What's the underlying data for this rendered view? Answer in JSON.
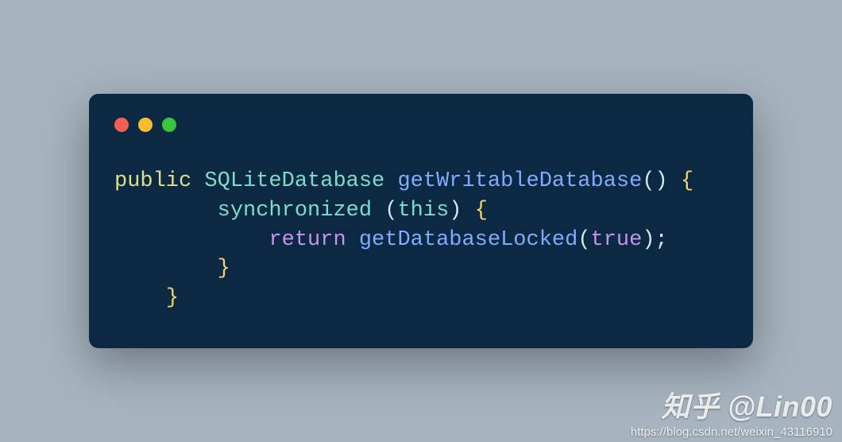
{
  "code": {
    "lang": "java",
    "tokens": [
      {
        "indent": "",
        "parts": [
          {
            "cls": "kw-public",
            "t": "public"
          },
          {
            "cls": "punct",
            "t": " "
          },
          {
            "cls": "type",
            "t": "SQLiteDatabase"
          },
          {
            "cls": "punct",
            "t": " "
          },
          {
            "cls": "method",
            "t": "getWritableDatabase"
          },
          {
            "cls": "punct",
            "t": "() "
          },
          {
            "cls": "brace",
            "t": "{"
          }
        ]
      },
      {
        "indent": "        ",
        "parts": [
          {
            "cls": "type",
            "t": "synchronized"
          },
          {
            "cls": "punct",
            "t": " ("
          },
          {
            "cls": "kw-this",
            "t": "this"
          },
          {
            "cls": "punct",
            "t": ") "
          },
          {
            "cls": "brace",
            "t": "{"
          }
        ]
      },
      {
        "indent": "            ",
        "parts": [
          {
            "cls": "kw-return",
            "t": "return"
          },
          {
            "cls": "punct",
            "t": " "
          },
          {
            "cls": "call",
            "t": "getDatabaseLocked"
          },
          {
            "cls": "punct",
            "t": "("
          },
          {
            "cls": "kw-true",
            "t": "true"
          },
          {
            "cls": "punct",
            "t": ");"
          }
        ]
      },
      {
        "indent": "        ",
        "parts": [
          {
            "cls": "brace",
            "t": "}"
          }
        ]
      },
      {
        "indent": "    ",
        "parts": [
          {
            "cls": "brace",
            "t": "}"
          }
        ]
      }
    ]
  },
  "watermark": {
    "author": "知乎 @Lin00",
    "url": "https://blog.csdn.net/weixin_43116910"
  }
}
